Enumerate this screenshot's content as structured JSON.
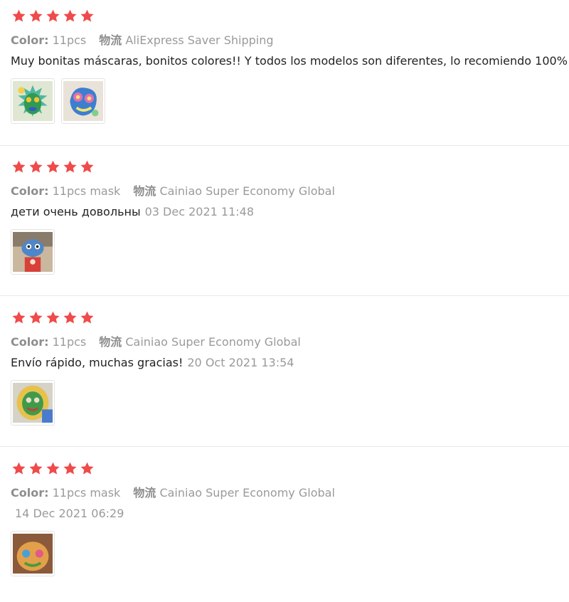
{
  "colors": {
    "star": "#f04a4a",
    "meta": "#9a9a9a",
    "text": "#222222",
    "divider": "#e8e8e8"
  },
  "reviews": [
    {
      "rating": 5,
      "color_label": "Color:",
      "color_value": "11pcs",
      "logistics_label": "物流",
      "logistics_value": "AliExpress Saver Shipping",
      "text": "Muy bonitas máscaras, bonitos colores!! Y todos los modelos son diferentes, lo recomiendo 100%",
      "date": "",
      "photos": [
        "mask-photo-green-blue",
        "mask-photo-pink-blue"
      ]
    },
    {
      "rating": 5,
      "color_label": "Color:",
      "color_value": "11pcs mask",
      "logistics_label": "物流",
      "logistics_value": "Cainiao Super Economy Global",
      "text": "дети очень довольны",
      "date": "03 Dec 2021 11:48",
      "photos": [
        "child-mask-photo"
      ]
    },
    {
      "rating": 5,
      "color_label": "Color:",
      "color_value": "11pcs",
      "logistics_label": "物流",
      "logistics_value": "Cainiao Super Economy Global",
      "text": "Envío rápido, muchas gracias!",
      "date": "20 Oct 2021 13:54",
      "photos": [
        "package-mask-photo"
      ]
    },
    {
      "rating": 5,
      "color_label": "Color:",
      "color_value": "11pcs mask",
      "logistics_label": "物流",
      "logistics_value": "Cainiao Super Economy Global",
      "text": "",
      "date": "14 Dec 2021 06:29",
      "photos": [
        "mask-photo-brown"
      ]
    }
  ]
}
